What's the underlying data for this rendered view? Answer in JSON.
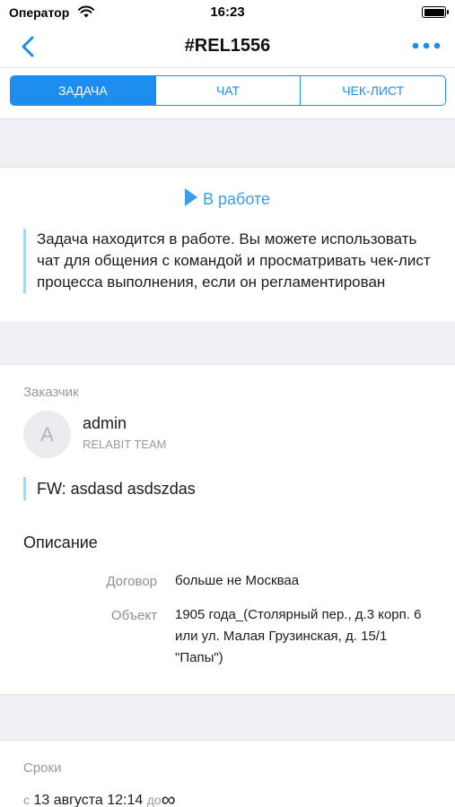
{
  "status_bar": {
    "carrier": "Оператор",
    "time": "16:23",
    "battery_level": 1.0,
    "wifi_icon": "wifi-icon",
    "battery_icon": "battery-icon"
  },
  "nav": {
    "title": "#REL1556",
    "back_icon": "chevron-left-icon",
    "more_icon": "more-dots-icon"
  },
  "tabs": [
    {
      "label": "ЗАДАЧА",
      "active": true
    },
    {
      "label": "ЧАТ",
      "active": false
    },
    {
      "label": "ЧЕК-ЛИСТ",
      "active": false
    }
  ],
  "status": {
    "label": "В работе",
    "icon": "play-icon",
    "description": "Задача находится в работе. Вы можете использовать чат для общения с командой и просматривать чек-лист процесса выполнения, если он регламентирован"
  },
  "customer": {
    "section_label": "Заказчик",
    "avatar_letter": "A",
    "name": "admin",
    "team": "RELABIT TEAM",
    "subject": "FW: asdasd asdszdas"
  },
  "description": {
    "heading": "Описание",
    "fields": [
      {
        "key": "Договор",
        "value": "больше не Москваа"
      },
      {
        "key": "Объект",
        "value": "1905 года_(Столярный пер., д.3 корп. 6 или ул. Малая Грузинская, д. 15/1 \"Папы\")"
      }
    ]
  },
  "terms": {
    "section_label": "Сроки",
    "from_prefix": "с",
    "from_date": "13 августа 12:14",
    "to_prefix": "до",
    "to_value": "∞"
  },
  "colors": {
    "accent": "#1d8ef0",
    "status": "#3aa0e8",
    "quote_bar": "#a9d6f2",
    "band": "#efeff4"
  }
}
